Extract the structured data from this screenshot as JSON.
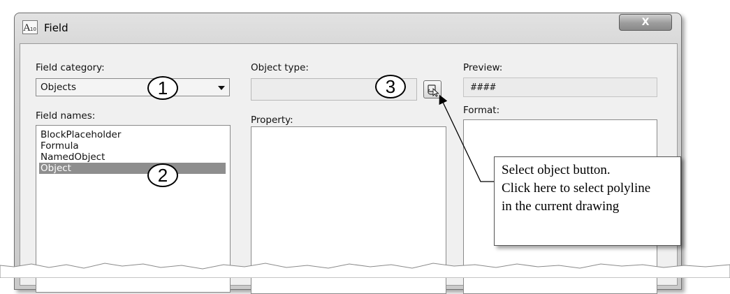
{
  "window": {
    "title": "Field",
    "icon": "autocad-field-icon",
    "close_label": "X"
  },
  "field_category": {
    "label": "Field category:",
    "value": "Objects"
  },
  "field_names": {
    "label": "Field names:",
    "items": [
      "BlockPlaceholder",
      "Formula",
      "NamedObject",
      "Object"
    ],
    "selected": "Object"
  },
  "object_type": {
    "label": "Object type:",
    "value": "",
    "select_button_icon": "select-object-icon"
  },
  "property": {
    "label": "Property:"
  },
  "preview": {
    "label": "Preview:",
    "value": "####"
  },
  "format": {
    "label": "Format:"
  },
  "callouts": [
    "1",
    "2",
    "3"
  ],
  "annotation": {
    "lines": [
      "Select object button.",
      "Click here to select polyline",
      "in the current drawing"
    ]
  },
  "colors": {
    "selection_highlight": "#8e8e8e",
    "dialog_background": "#f0f0f0"
  }
}
